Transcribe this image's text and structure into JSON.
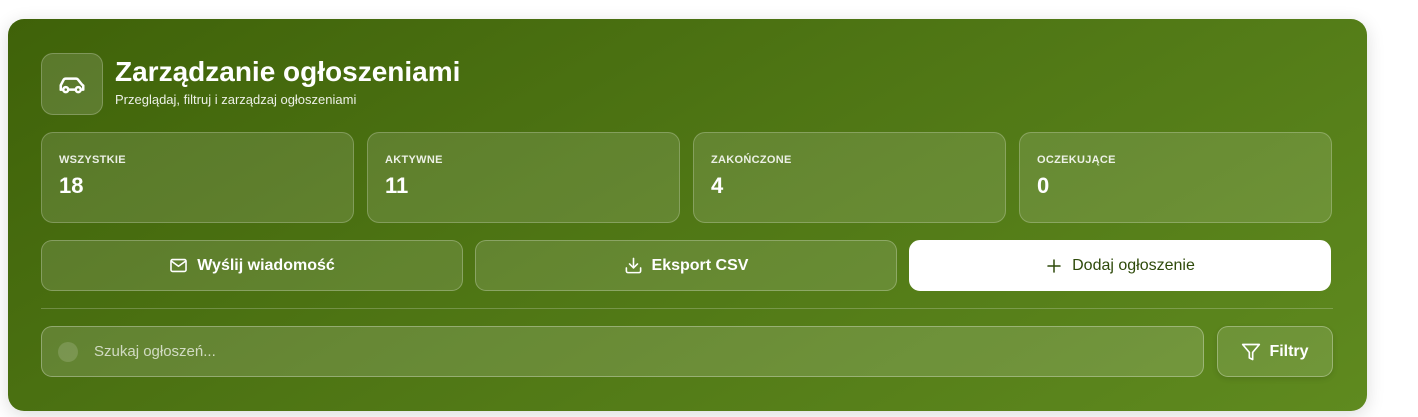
{
  "header": {
    "title": "Zarządzanie ogłoszeniami",
    "subtitle": "Przeglądaj, filtruj i zarządzaj ogłoszeniami",
    "icon": "car-icon"
  },
  "stats": [
    {
      "label": "WSZYSTKIE",
      "value": "18"
    },
    {
      "label": "AKTYWNE",
      "value": "11"
    },
    {
      "label": "ZAKOŃCZONE",
      "value": "4"
    },
    {
      "label": "OCZEKUJĄCE",
      "value": "0"
    }
  ],
  "actions": {
    "message_label": "Wyślij wiadomość",
    "message_icon": "mail-icon",
    "export_label": "Eksport CSV",
    "export_icon": "download-icon",
    "add_label": "Dodaj ogłoszenie",
    "add_icon": "plus-icon"
  },
  "search": {
    "placeholder": "Szukaj ogłoszeń...",
    "value": ""
  },
  "filters": {
    "label": "Filtry",
    "icon": "filter-icon"
  },
  "colors": {
    "panel_start": "#3f6209",
    "panel_end": "#5f8a1f",
    "primary_button_bg": "#ffffff",
    "primary_button_text": "#2e4a0a"
  }
}
